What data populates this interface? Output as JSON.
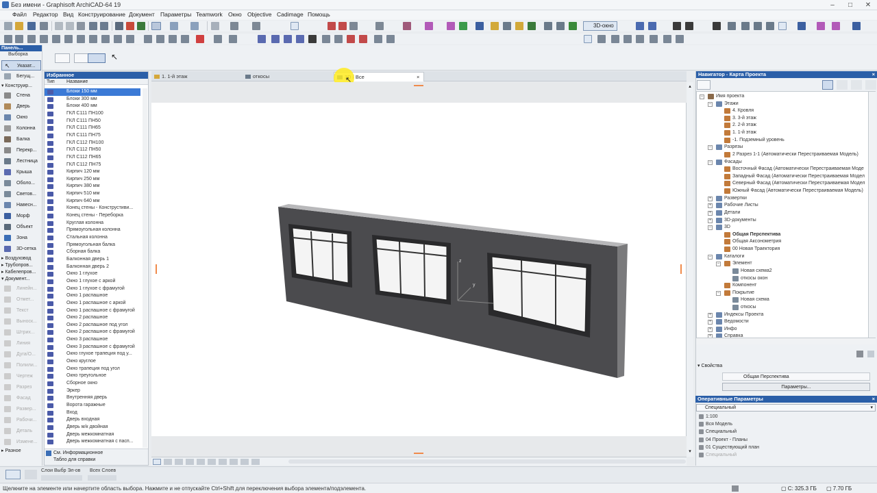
{
  "window": {
    "title": "Без имени - Graphisoft ArchiCAD-64 19"
  },
  "menu": [
    "Файл",
    "Редактор",
    "Вид",
    "Конструирование",
    "Документ",
    "Параметры",
    "Teamwork",
    "Окно",
    "Objective",
    "Cadimage",
    "Помощь"
  ],
  "toolbar": {
    "view_3d_label": "3D-окно"
  },
  "toolbox": {
    "title": "Панель...",
    "select_label": "Выборка",
    "pointer_label": "Указат...",
    "marquee_label": "Бегущ...",
    "design_group": "Конструир...",
    "design_tools": [
      "Стена",
      "Дверь",
      "Окно",
      "Колонна",
      "Балка",
      "Перекр...",
      "Лестница",
      "Крыша",
      "Оболо...",
      "Светов...",
      "Навесн...",
      "Морф",
      "Объект",
      "Зона",
      "3D-сетка"
    ],
    "groups": [
      "Воздуховод",
      "Трубопров...",
      "Кабелепров..."
    ],
    "document_group": "Документ...",
    "document_tools": [
      "Линейн...",
      "Отмет...",
      "Текст",
      "Выноск...",
      "Штрих...",
      "Линия",
      "Дуга/О...",
      "Полили...",
      "Чертеж",
      "Разрез",
      "Фасад",
      "Развер...",
      "Рабочи...",
      "Деталь",
      "Измене..."
    ],
    "more_label": "Разное"
  },
  "favorites": {
    "title": "Избранное",
    "col_type": "Тип",
    "col_name": "Название",
    "items": [
      "Блоки 150 мм",
      "Блоки 300 мм",
      "Блоки 400 мм",
      "ГКЛ С111 ПН100",
      "ГКЛ С111 ПН50",
      "ГКЛ С111 ПН65",
      "ГКЛ С111 ПН75",
      "ГКЛ С112 ПН100",
      "ГКЛ С112 ПН50",
      "ГКЛ С112 ПН65",
      "ГКЛ С112 ПН75",
      "Кирпич 120 мм",
      "Кирпич 250 мм",
      "Кирпич 380 мм",
      "Кирпич 510 мм",
      "Кирпич 640 мм",
      "Конец стены - Конструстиви...",
      "Конец стены - Переборка",
      "Круглая колонна",
      "Прямоугольная колонна",
      "Стальная колонна",
      "Прямоугольная балка",
      "Сборная балка",
      "Балконная дверь 1",
      "Балконная дверь 2",
      "Окно 1 глухое",
      "Окно 1 глухое с аркой",
      "Окно 1 глухое с фрамугой",
      "Окно 1 распашное",
      "Окно 1 распашное с аркой",
      "Окно 1 распашное с фрамугой",
      "Окно 2 распашное",
      "Окно 2 распашное под угол",
      "Окно 2 распашное с фрамугой",
      "Окно 3 распашное",
      "Окно 3 распашное с фрамугой",
      "Окно глухое трапеция под у...",
      "Окно круглое",
      "Окно трапеция под угол",
      "Окно треугольное",
      "Сборное окно",
      "Эркер",
      "Внутренняя дверь",
      "Ворота гаражные",
      "Вход",
      "Дверь входная",
      "Дверь м/к двойная",
      "Дверь межкомнатная",
      "Дверь межкомнатная с пасп..."
    ],
    "footer1": "См. Информационное",
    "footer2": "Табло для справки"
  },
  "tabs": [
    "1. 1-й этаж",
    "откосы",
    "3D / Все"
  ],
  "axis_labels": {
    "z": "z",
    "y": "y"
  },
  "navigator": {
    "title": "Навигатор - Карта Проекта",
    "tree": [
      {
        "label": "Имя проекта",
        "level": 0
      },
      {
        "label": "Этажи",
        "level": 1
      },
      {
        "label": "4. Кровля",
        "level": 2
      },
      {
        "label": "3. 3-й этаж",
        "level": 2
      },
      {
        "label": "2. 2-й этаж",
        "level": 2
      },
      {
        "label": "1. 1-й этаж",
        "level": 2
      },
      {
        "label": "-1. Подземный уровень",
        "level": 2
      },
      {
        "label": "Разрезы",
        "level": 1
      },
      {
        "label": "2 Разрез 1-1 (Автоматически Перестраиваемая Модель)",
        "level": 2
      },
      {
        "label": "Фасады",
        "level": 1
      },
      {
        "label": "Восточный Фасад (Автоматически Перестраиваемая Моде",
        "level": 2
      },
      {
        "label": "Западный Фасад (Автоматически Перестраиваемая Модел",
        "level": 2
      },
      {
        "label": "Северный Фасад (Автоматически Перестраиваемая Модел",
        "level": 2
      },
      {
        "label": "Южный Фасад (Автоматически Перестраиваемая Модель)",
        "level": 2
      },
      {
        "label": "Развертки",
        "level": 1
      },
      {
        "label": "Рабочие Листы",
        "level": 1
      },
      {
        "label": "Детали",
        "level": 1
      },
      {
        "label": "3D-документы",
        "level": 1
      },
      {
        "label": "3D",
        "level": 1
      },
      {
        "label": "Общая Перспектива",
        "level": 2
      },
      {
        "label": "Общая Аксонометрия",
        "level": 2
      },
      {
        "label": "00 Новая Траектория",
        "level": 2
      },
      {
        "label": "Каталоги",
        "level": 1
      },
      {
        "label": "Элемент",
        "level": 2
      },
      {
        "label": "Новая схема2",
        "level": 3
      },
      {
        "label": "откосы окон",
        "level": 3
      },
      {
        "label": "Компонент",
        "level": 2
      },
      {
        "label": "Покрытие",
        "level": 2
      },
      {
        "label": "Новая схема",
        "level": 3
      },
      {
        "label": "откосы",
        "level": 3
      },
      {
        "label": "Индексы Проекта",
        "level": 1
      },
      {
        "label": "Ведомости",
        "level": 1
      },
      {
        "label": "Инфо",
        "level": 1
      },
      {
        "label": "Справка",
        "level": 1
      }
    ],
    "selected_item": "Общая Перспектива",
    "properties_label": "Свойства",
    "properties_value": "Общая Перспектива",
    "params_button": "Параметры..."
  },
  "quick_options": {
    "title": "Оперативные Параметры",
    "dropdown": "Специальный",
    "items": [
      "1:100",
      "Вся Модель",
      "Специальный",
      "04 Проект - Планы",
      "01 Существующий план",
      "Специальный"
    ]
  },
  "bottombar": {
    "layers_label": "Слои Выбр Эл-ов",
    "all_layers_label": "Всех Слоев"
  },
  "status": {
    "message": "Щелкните на элементе или начертите область выбора. Нажмите и не отпускайте Ctrl+Shift для переключения выбора элемента/подэлемента.",
    "disk1": "С: 325.3 ГБ",
    "disk2": "7.70 ГБ"
  },
  "colors": {
    "accent": "#2b5fa8",
    "selection": "#3b7ad6",
    "wall": "#4b4b4e"
  }
}
